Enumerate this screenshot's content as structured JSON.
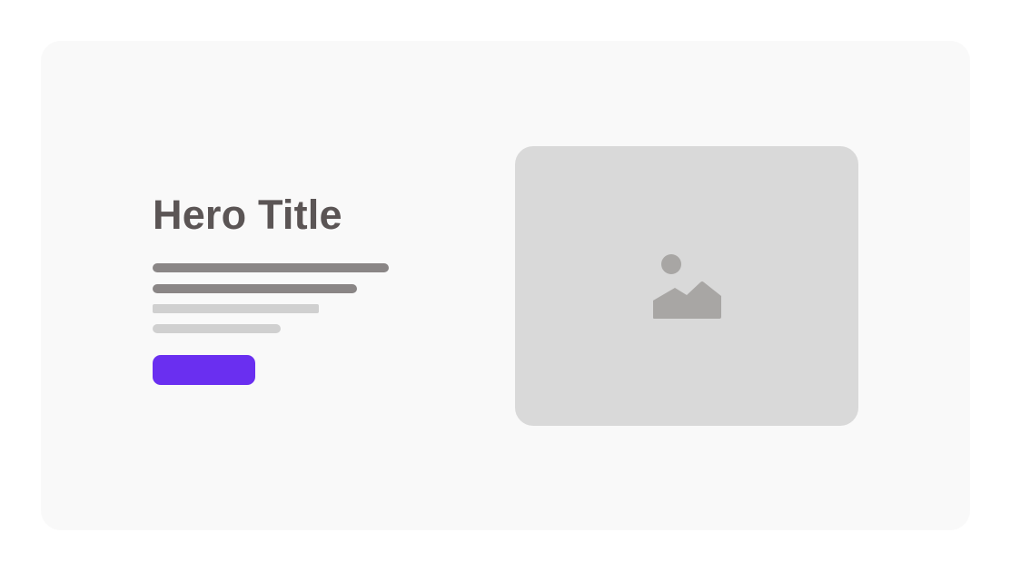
{
  "hero": {
    "title": "Hero Title",
    "cta_label": ""
  },
  "media": {
    "icon": "image-placeholder-icon"
  },
  "colors": {
    "card_background": "#f9f9f9",
    "title_text": "#5b5555",
    "text_line_dark": "#8a8686",
    "text_line_light": "#d0d0d0",
    "cta_button": "#6a2ff0",
    "media_background": "#d9d9d9",
    "media_icon": "#a8a6a4"
  }
}
